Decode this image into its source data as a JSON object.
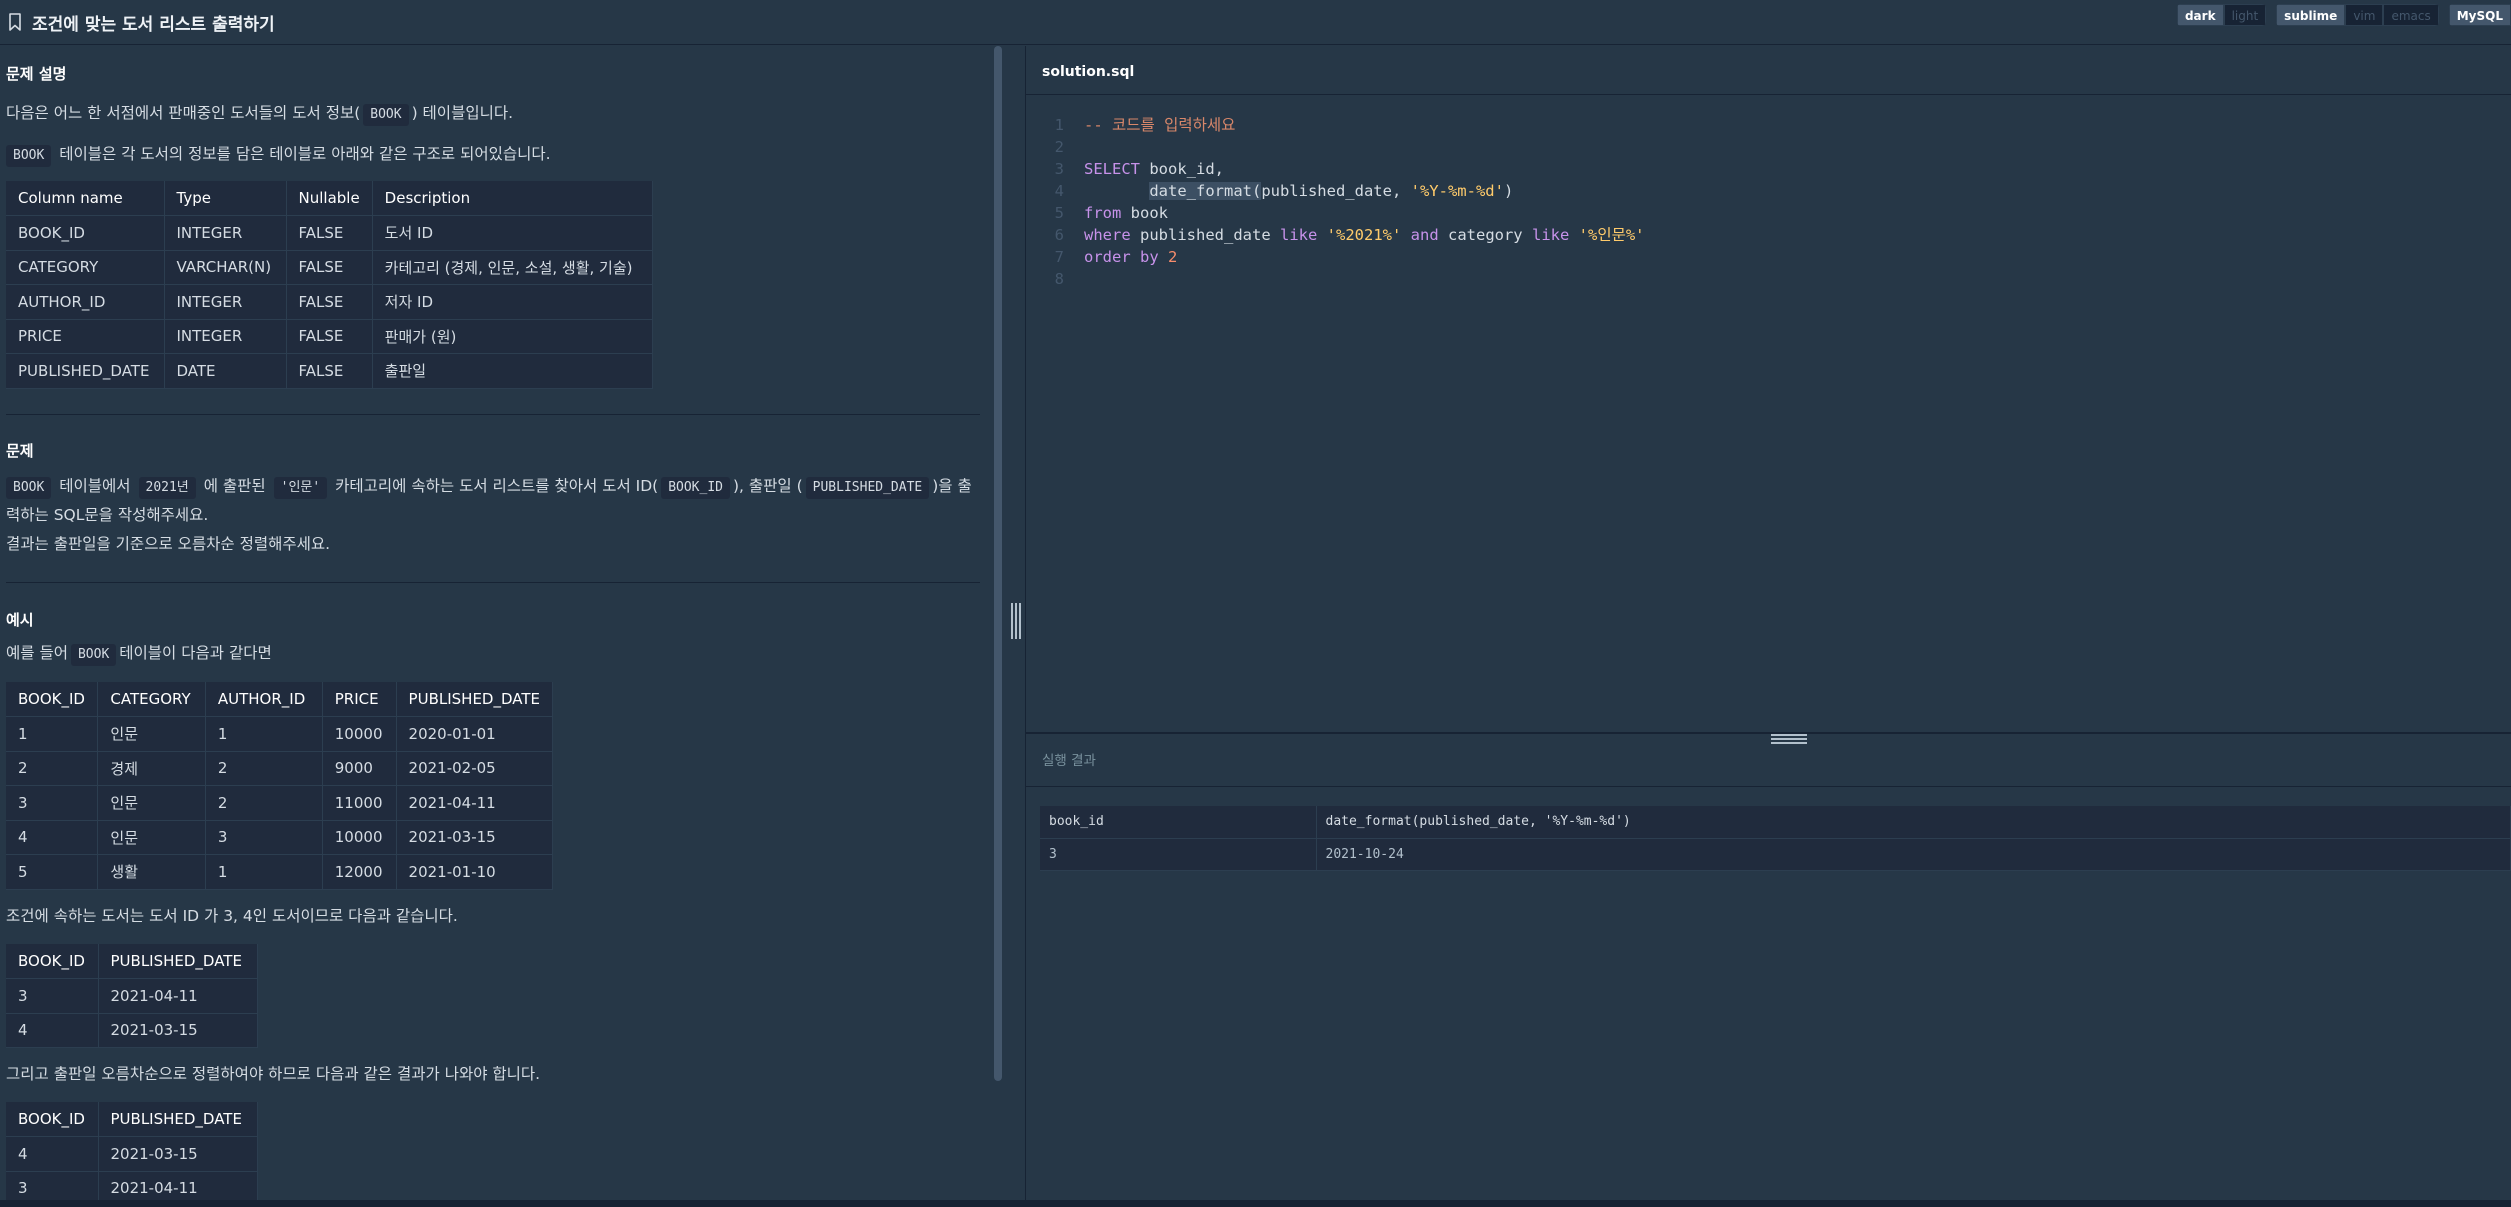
{
  "header": {
    "title": "조건에 맞는 도서 리스트 출력하기",
    "icons": {
      "bookmark": "bookmark-icon"
    },
    "theme_options": [
      "dark",
      "light"
    ],
    "keymap_options": [
      "sublime",
      "vim",
      "emacs"
    ],
    "language": "MySQL"
  },
  "problem": {
    "desc_title": "문제 설명",
    "desc_p1_a": "다음은 어느 한 서점에서 판매중인 도서들의 도서 정보(",
    "desc_p1_code": "BOOK",
    "desc_p1_b": ") 테이블입니다.",
    "desc_p2_code": "BOOK",
    "desc_p2_b": "테이블은 각 도서의 정보를 담은 테이블로 아래와 같은 구조로 되어있습니다.",
    "schema_headers": [
      "Column name",
      "Type",
      "Nullable",
      "Description"
    ],
    "schema_rows": [
      [
        "BOOK_ID",
        "INTEGER",
        "FALSE",
        "도서 ID"
      ],
      [
        "CATEGORY",
        "VARCHAR(N)",
        "FALSE",
        "카테고리 (경제, 인문, 소설, 생활, 기술)"
      ],
      [
        "AUTHOR_ID",
        "INTEGER",
        "FALSE",
        "저자 ID"
      ],
      [
        "PRICE",
        "INTEGER",
        "FALSE",
        "판매가 (원)"
      ],
      [
        "PUBLISHED_DATE",
        "DATE",
        "FALSE",
        "출판일"
      ]
    ],
    "q_title": "문제",
    "q_code1": "BOOK",
    "q_t1": "테이블에서",
    "q_code2": "2021년",
    "q_t2": "에 출판된",
    "q_code3": "'인문'",
    "q_t3": "카테고리에 속하는 도서 리스트를 찾아서 도서 ID(",
    "q_code4": "BOOK_ID",
    "q_t4": "), 출판일 (",
    "q_code5": "PUBLISHED_DATE",
    "q_t5": ")을 출",
    "q_line2": "력하는 SQL문을 작성해주세요.",
    "q_line3": "결과는 출판일을 기준으로 오름차순 정렬해주세요.",
    "ex_title": "예시",
    "ex_p1_a": "예를 들어",
    "ex_p1_code": "BOOK",
    "ex_p1_b": "테이블이 다음과 같다면",
    "ex_headers": [
      "BOOK_ID",
      "CATEGORY",
      "AUTHOR_ID",
      "PRICE",
      "PUBLISHED_DATE"
    ],
    "ex_rows": [
      [
        "1",
        "인문",
        "1",
        "10000",
        "2020-01-01"
      ],
      [
        "2",
        "경제",
        "2",
        "9000",
        "2021-02-05"
      ],
      [
        "3",
        "인문",
        "2",
        "11000",
        "2021-04-11"
      ],
      [
        "4",
        "인문",
        "3",
        "10000",
        "2021-03-15"
      ],
      [
        "5",
        "생활",
        "1",
        "12000",
        "2021-01-10"
      ]
    ],
    "ex_p2": "조건에 속하는 도서는 도서 ID 가 3, 4인 도서이므로 다음과 같습니다.",
    "ex2_headers": [
      "BOOK_ID",
      "PUBLISHED_DATE"
    ],
    "ex2_rows": [
      [
        "3",
        "2021-04-11"
      ],
      [
        "4",
        "2021-03-15"
      ]
    ],
    "ex_p3": "그리고 출판일 오름차순으로 정렬하여야 하므로 다음과 같은 결과가 나와야 합니다.",
    "ex3_headers": [
      "BOOK_ID",
      "PUBLISHED_DATE"
    ],
    "ex3_rows": [
      [
        "4",
        "2021-03-15"
      ],
      [
        "3",
        "2021-04-11"
      ]
    ]
  },
  "editor": {
    "file_name": "solution.sql",
    "line_numbers": [
      "1",
      "2",
      "3",
      "4",
      "5",
      "6",
      "7",
      "8"
    ],
    "line1": "-- 코드를 입력하세요",
    "line3_kw": "SELECT",
    "line3_rest": " book_id,",
    "line4_indent": "       ",
    "line4_fn": "date_format(",
    "line4_mid": "published_date, ",
    "line4_str": "'%Y-%m-%d'",
    "line4_end": ")",
    "line5_kw": "from",
    "line5_rest": " book",
    "line6_kw1": "where",
    "line6_a": " published_date ",
    "line6_kw2": "like",
    "line6_s1": "'%2021%'",
    "line6_kw3": "and",
    "line6_b": " category ",
    "line6_kw4": "like",
    "line6_s2": "'%인문%'",
    "line7_kw": "order by",
    "line7_num": "2"
  },
  "result": {
    "label": "실행 결과",
    "headers": [
      "book_id",
      "date_format(published_date, '%Y-%m-%d')"
    ],
    "rows": [
      [
        "3",
        "2021-10-24"
      ]
    ]
  },
  "colors": {
    "background": "#263747",
    "table_bg": "#202b3d",
    "keyword": "#c792ea",
    "string": "#ffcb6b",
    "comment": "#d8876a",
    "number": "#f78c6c"
  }
}
